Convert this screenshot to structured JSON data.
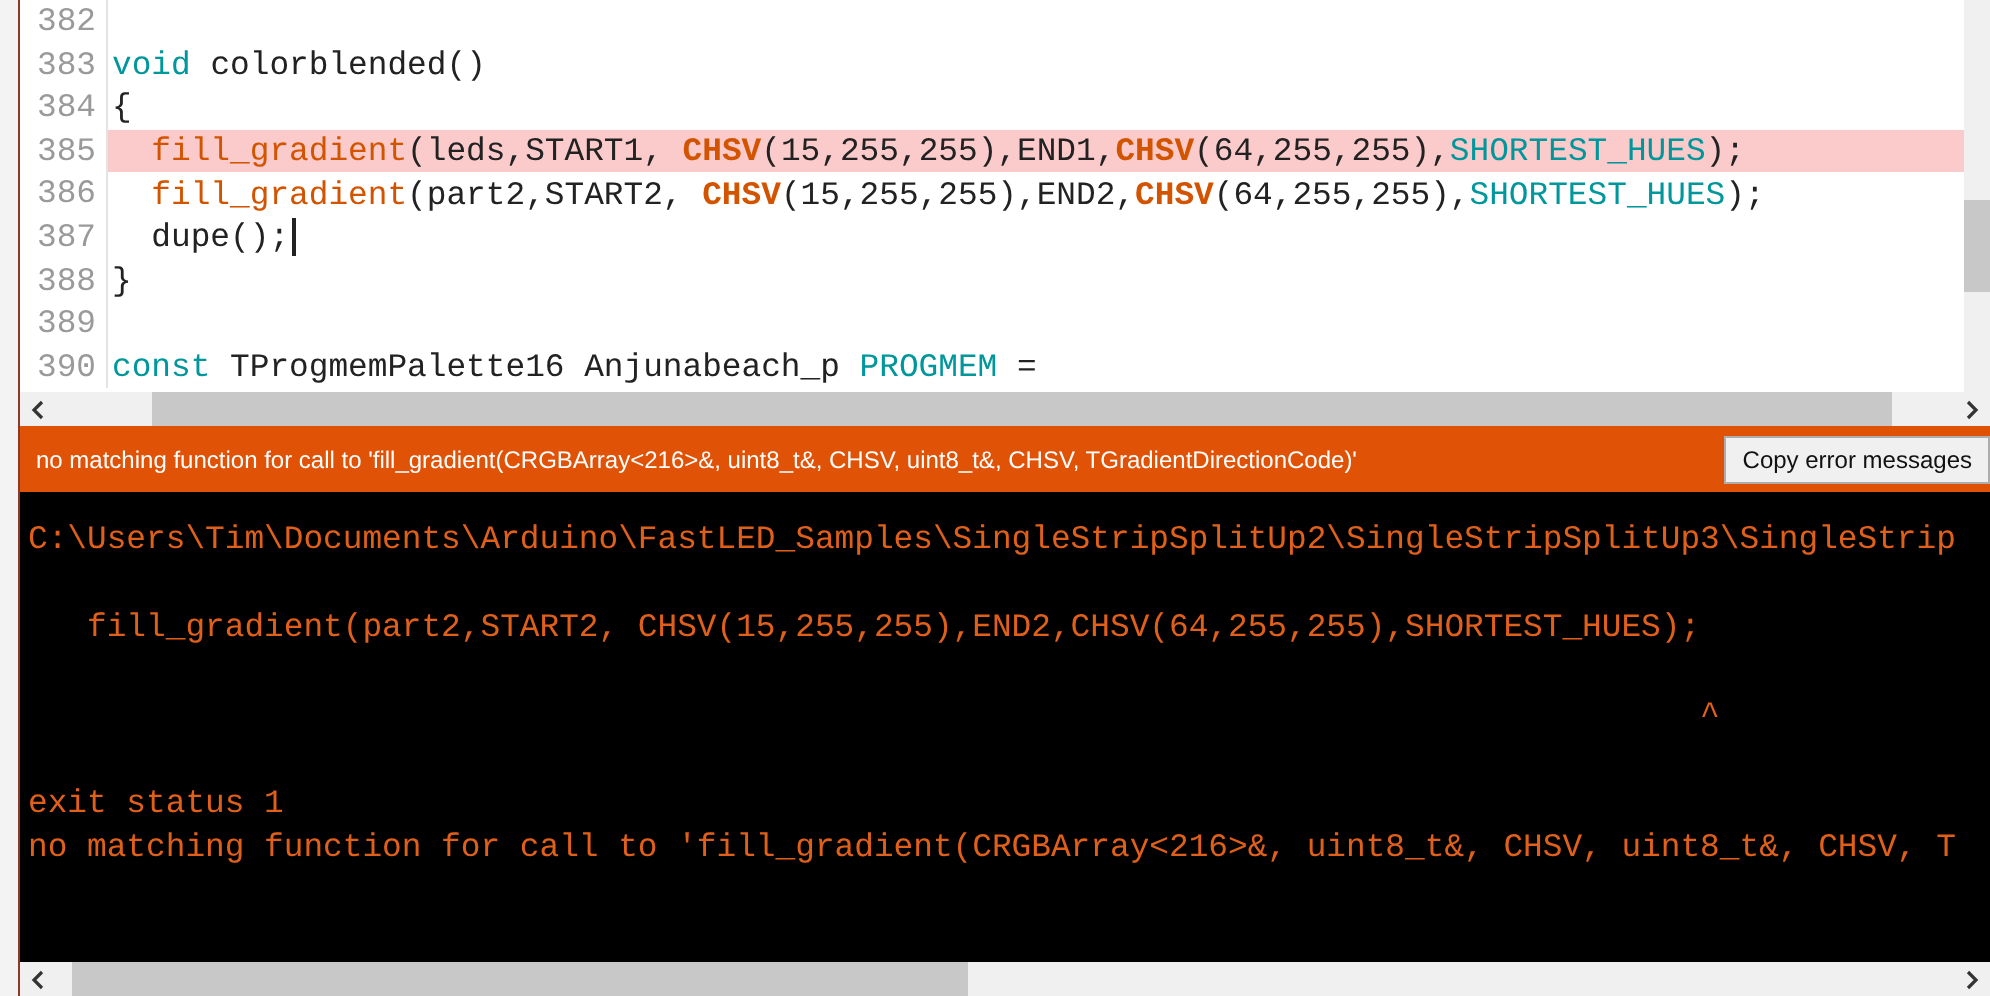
{
  "editor": {
    "lines": [
      {
        "number": "382",
        "highlighted": false,
        "cursor": false
      },
      {
        "number": "383",
        "highlighted": false,
        "cursor": false,
        "tokens": [
          {
            "text": "void",
            "kind": "keyword"
          },
          {
            "text": " colorblended()",
            "kind": "plain"
          }
        ]
      },
      {
        "number": "384",
        "highlighted": false,
        "cursor": false,
        "tokens": [
          {
            "text": "{",
            "kind": "plain"
          }
        ]
      },
      {
        "number": "385",
        "highlighted": true,
        "cursor": false,
        "tokens": [
          {
            "text": "  fill_gradient",
            "kind": "function"
          },
          {
            "text": "(leds,START1, ",
            "kind": "plain"
          },
          {
            "text": "CHSV",
            "kind": "type"
          },
          {
            "text": "(15,255,255),END1,",
            "kind": "plain"
          },
          {
            "text": "CHSV",
            "kind": "type"
          },
          {
            "text": "(64,255,255),",
            "kind": "plain"
          },
          {
            "text": "SHORTEST_HUES",
            "kind": "constant"
          },
          {
            "text": ");",
            "kind": "plain"
          }
        ]
      },
      {
        "number": "386",
        "highlighted": false,
        "cursor": false,
        "tokens": [
          {
            "text": "  fill_gradient",
            "kind": "function"
          },
          {
            "text": "(part2,START2, ",
            "kind": "plain"
          },
          {
            "text": "CHSV",
            "kind": "type"
          },
          {
            "text": "(15,255,255),END2,",
            "kind": "plain"
          },
          {
            "text": "CHSV",
            "kind": "type"
          },
          {
            "text": "(64,255,255),",
            "kind": "plain"
          },
          {
            "text": "SHORTEST_HUES",
            "kind": "constant"
          },
          {
            "text": ");",
            "kind": "plain"
          }
        ]
      },
      {
        "number": "387",
        "highlighted": false,
        "cursor": true,
        "tokens": [
          {
            "text": "  dupe();",
            "kind": "plain"
          }
        ]
      },
      {
        "number": "388",
        "highlighted": false,
        "cursor": false,
        "tokens": [
          {
            "text": "}",
            "kind": "plain"
          }
        ]
      },
      {
        "number": "389",
        "highlighted": false,
        "cursor": false
      },
      {
        "number": "390",
        "highlighted": false,
        "cursor": false,
        "tokens": [
          {
            "text": "const",
            "kind": "keyword"
          },
          {
            "text": " TProgmemPalette16 Anjunabeach_p ",
            "kind": "plain"
          },
          {
            "text": "PROGMEM",
            "kind": "constant"
          },
          {
            "text": " =",
            "kind": "plain"
          }
        ]
      }
    ]
  },
  "error_bar": {
    "message": "no matching function for call to 'fill_gradient(CRGBArray<216>&, uint8_t&, CHSV, uint8_t&, CHSV, TGradientDirectionCode)'",
    "button": "Copy error messages"
  },
  "console": {
    "lines": [
      {
        "kind": "text",
        "text": "C:\\Users\\Tim\\Documents\\Arduino\\FastLED_Samples\\SingleStripSplitUp2\\SingleStripSplitUp3\\SingleStrip"
      },
      {
        "kind": "blank"
      },
      {
        "kind": "text",
        "text": "   fill_gradient(part2,START2, CHSV(15,255,255),END2,CHSV(64,255,255),SHORTEST_HUES);"
      },
      {
        "kind": "blank"
      },
      {
        "kind": "text",
        "text": "                                                                                     ^"
      },
      {
        "kind": "blank"
      },
      {
        "kind": "text",
        "text": "exit status 1"
      },
      {
        "kind": "text",
        "text": "no matching function for call to 'fill_gradient(CRGBArray<216>&, uint8_t&, CHSV, uint8_t&, CHSV, T"
      }
    ]
  }
}
